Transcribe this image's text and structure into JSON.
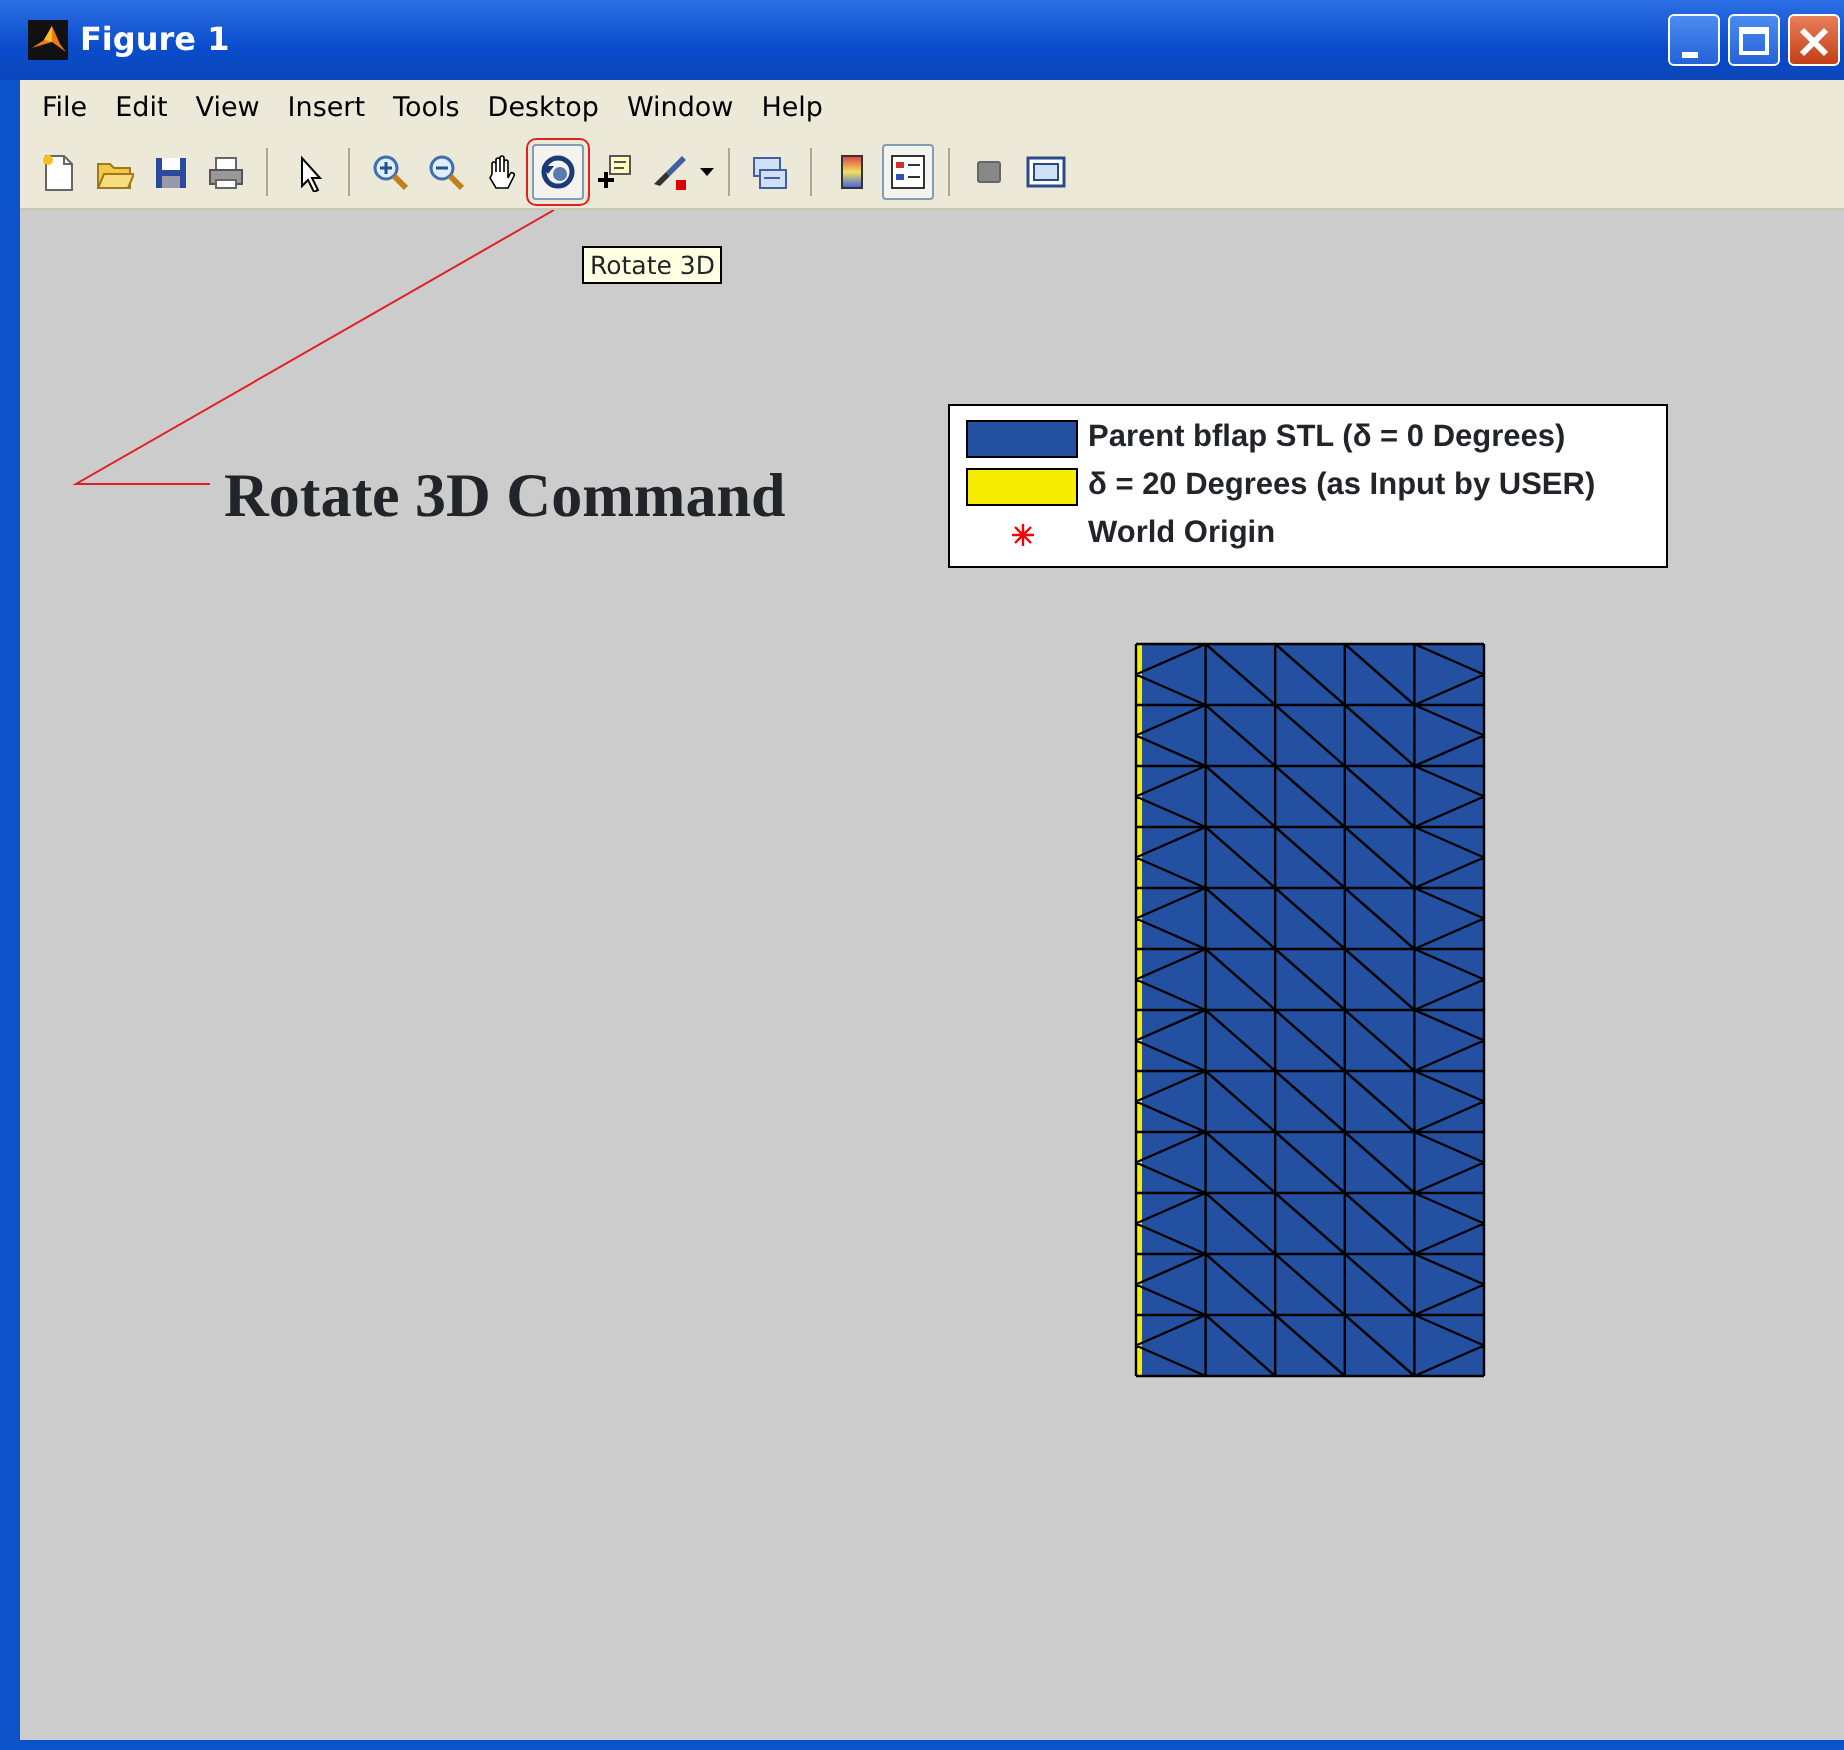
{
  "window": {
    "title": "Figure 1"
  },
  "menu": [
    "File",
    "Edit",
    "View",
    "Insert",
    "Tools",
    "Desktop",
    "Window",
    "Help"
  ],
  "toolbar": [
    {
      "kind": "new",
      "selected": false
    },
    {
      "kind": "open",
      "selected": false
    },
    {
      "kind": "save",
      "selected": false
    },
    {
      "kind": "print",
      "selected": false
    },
    {
      "kind": "separator"
    },
    {
      "kind": "pointer",
      "selected": false
    },
    {
      "kind": "separator"
    },
    {
      "kind": "zoom-in",
      "selected": false
    },
    {
      "kind": "zoom-out",
      "selected": false
    },
    {
      "kind": "pan",
      "selected": false
    },
    {
      "kind": "rotate",
      "selected": true
    },
    {
      "kind": "data-cursor",
      "selected": false
    },
    {
      "kind": "brush",
      "selected": false
    },
    {
      "kind": "separator"
    },
    {
      "kind": "link",
      "selected": false
    },
    {
      "kind": "separator"
    },
    {
      "kind": "colorbar",
      "selected": false
    },
    {
      "kind": "legend",
      "selected": true
    },
    {
      "kind": "separator"
    },
    {
      "kind": "hide-tools",
      "selected": false
    },
    {
      "kind": "show-tools",
      "selected": false
    }
  ],
  "tooltip": "Rotate 3D",
  "annotation": "Rotate 3D Command",
  "legend": [
    {
      "kind": "patch",
      "label": "Parent bflap STL (δ = 0 Degrees)",
      "color": "#2350a0"
    },
    {
      "kind": "patch",
      "label": "δ = 20 Degrees (as Input by USER)",
      "color": "#f5ec00"
    },
    {
      "kind": "marker",
      "label": "World Origin",
      "color": "#ff0000"
    }
  ]
}
